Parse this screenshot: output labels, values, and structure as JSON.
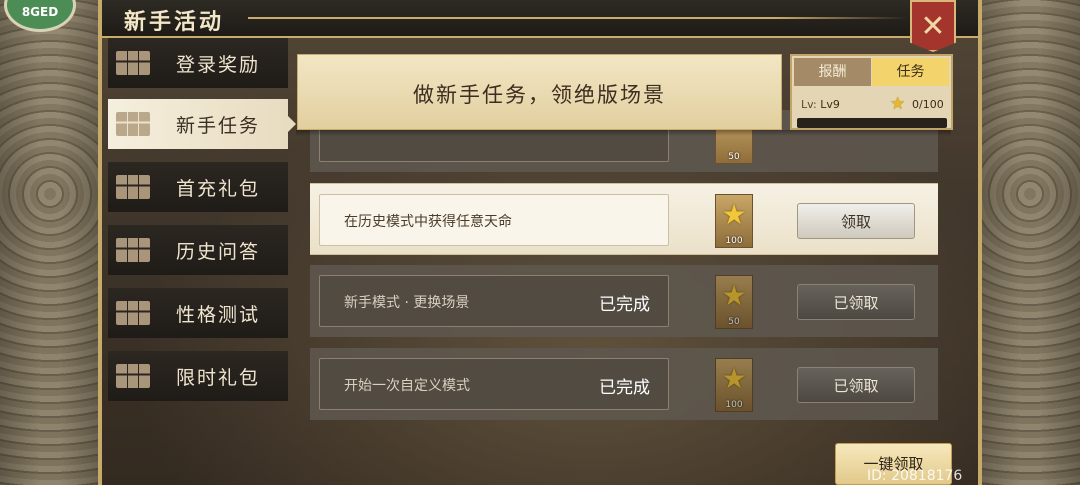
{
  "header": {
    "title": "新手活动",
    "corner_badge": "8GED",
    "close_icon": "close-icon"
  },
  "sidebar": {
    "items": [
      {
        "label": "登录奖励",
        "icon": "menu-grid-icon",
        "active": false
      },
      {
        "label": "新手任务",
        "icon": "menu-grid-icon",
        "active": true
      },
      {
        "label": "首充礼包",
        "icon": "menu-grid-icon",
        "active": false
      },
      {
        "label": "历史问答",
        "icon": "menu-grid-icon",
        "active": false
      },
      {
        "label": "性格测试",
        "icon": "menu-grid-icon",
        "active": false
      },
      {
        "label": "限时礼包",
        "icon": "menu-grid-icon",
        "active": false
      }
    ]
  },
  "banner": {
    "text": "做新手任务，领绝版场景"
  },
  "tabs": {
    "reward_label": "报酬",
    "task_label": "任务",
    "selected": "任务"
  },
  "level": {
    "label": "Lv:",
    "value": "Lv9"
  },
  "progress": {
    "text": "0/100",
    "fraction": 0.0
  },
  "tasks": [
    {
      "name": "",
      "status": "",
      "reward_amount": "50",
      "button": "",
      "state": "partial"
    },
    {
      "name": "在历史模式中获得任意天命",
      "status": "",
      "reward_amount": "100",
      "button": "领取",
      "state": "pending"
    },
    {
      "name": "新手模式 · 更换场景",
      "status": "已完成",
      "reward_amount": "50",
      "button": "已领取",
      "state": "done"
    },
    {
      "name": "开始一次自定义模式",
      "status": "已完成",
      "reward_amount": "100",
      "button": "已领取",
      "state": "done"
    }
  ],
  "footer": {
    "one_key_claim": "一键领取",
    "user_id": "ID: 20818176"
  },
  "colors": {
    "accent_gold": "#c9ab6b",
    "close_red": "#a3352c",
    "tab_selected": "#f3d46c"
  }
}
